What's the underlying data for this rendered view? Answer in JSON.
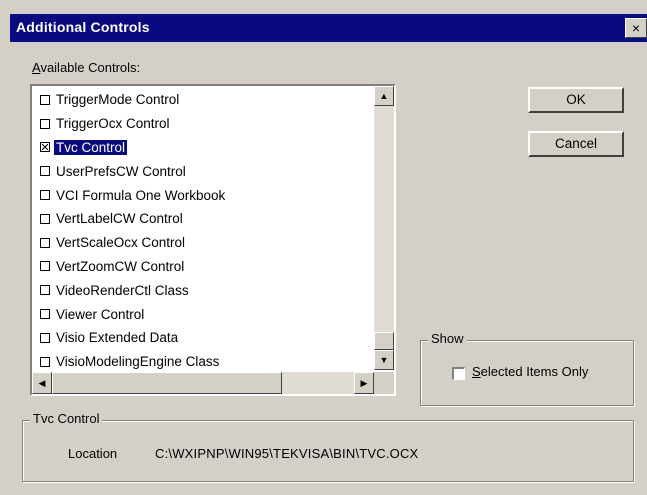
{
  "window": {
    "title": "Additional Controls",
    "close_glyph": "×"
  },
  "available": {
    "label_accel": "A",
    "label_rest": "vailable Controls:"
  },
  "list": {
    "items": [
      {
        "label": "TriggerMode Control",
        "checked": false,
        "selected": false
      },
      {
        "label": "TriggerOcx Control",
        "checked": false,
        "selected": false
      },
      {
        "label": "Tvc Control",
        "checked": true,
        "selected": true
      },
      {
        "label": "UserPrefsCW Control",
        "checked": false,
        "selected": false
      },
      {
        "label": "VCI Formula One Workbook",
        "checked": false,
        "selected": false
      },
      {
        "label": "VertLabelCW Control",
        "checked": false,
        "selected": false
      },
      {
        "label": "VertScaleOcx Control",
        "checked": false,
        "selected": false
      },
      {
        "label": "VertZoomCW Control",
        "checked": false,
        "selected": false
      },
      {
        "label": "VideoRenderCtl Class",
        "checked": false,
        "selected": false
      },
      {
        "label": "Viewer Control",
        "checked": false,
        "selected": false
      },
      {
        "label": "Visio Extended Data",
        "checked": false,
        "selected": false
      },
      {
        "label": "VisioModelingEngine Class",
        "checked": false,
        "selected": false
      }
    ]
  },
  "buttons": {
    "ok": "OK",
    "cancel": "Cancel"
  },
  "show": {
    "group_label": "Show",
    "selected_only_accel": "S",
    "selected_only_rest": "elected Items Only",
    "selected_only_checked": false
  },
  "details": {
    "group_label": "Tvc Control",
    "location_label": "Location",
    "location_value": "C:\\WXIPNP\\WIN95\\TEKVISA\\BIN\\TVC.OCX"
  },
  "icons": {
    "scroll_up": "up-arrow-icon",
    "scroll_down": "down-arrow-icon",
    "scroll_left": "left-arrow-icon",
    "scroll_right": "right-arrow-icon"
  },
  "colors": {
    "title_bar": "#0a0a80",
    "selection": "#0a0a80",
    "face": "#d4d0c8"
  }
}
